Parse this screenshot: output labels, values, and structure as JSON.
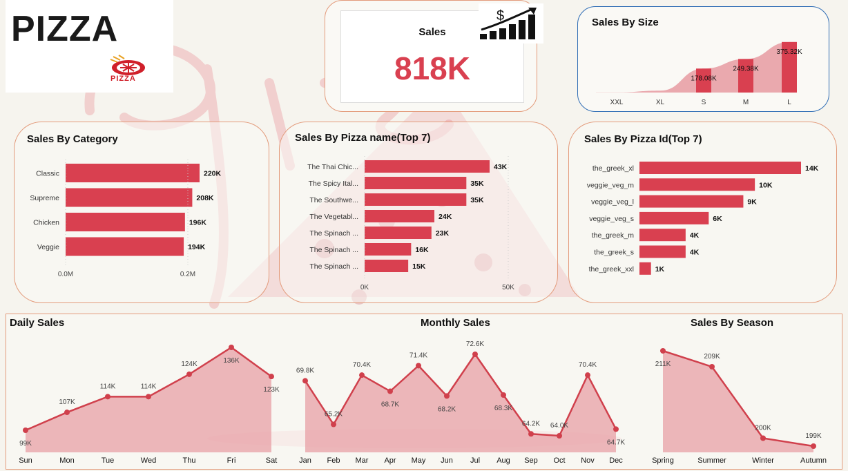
{
  "logo": {
    "word": "PIZZA",
    "sub": "PIZZA"
  },
  "kpi": {
    "label": "Sales",
    "value": "818K",
    "icon": "dollar-growth-bars-icon"
  },
  "colors": {
    "bar": "#d94050",
    "area": "#e8a0a6",
    "line": "#d0404c",
    "accent_border": "#e39a7a",
    "size_border": "#2f6db5"
  },
  "chart_data": [
    {
      "id": "size",
      "type": "area",
      "title": "Sales By Size",
      "categories": [
        "XXL",
        "XL",
        "S",
        "M",
        "L"
      ],
      "values": [
        1006,
        14076,
        178076,
        249382,
        375319
      ],
      "data_labels": [
        "",
        "",
        "178.08K",
        "249.38K",
        "375.32K"
      ]
    },
    {
      "id": "category",
      "type": "bar",
      "orientation": "horizontal",
      "title": "Sales By Category",
      "categories": [
        "Classic",
        "Supreme",
        "Chicken",
        "Veggie"
      ],
      "values": [
        220000,
        208000,
        196000,
        194000
      ],
      "data_labels": [
        "220K",
        "208K",
        "196K",
        "194K"
      ],
      "xlim": [
        0,
        0.2
      ],
      "tick_labels": [
        "0.0M",
        "0.2M"
      ]
    },
    {
      "id": "pizza_name",
      "type": "bar",
      "orientation": "horizontal",
      "title": "Sales By Pizza name(Top 7)",
      "categories": [
        "The Thai Chic...",
        "The Spicy Ital...",
        "The Southwe...",
        "The Vegetabl...",
        "The Spinach ...",
        "The Spinach ...",
        "The Spinach ..."
      ],
      "values": [
        43000,
        35000,
        35000,
        24000,
        23000,
        16000,
        15000
      ],
      "data_labels": [
        "43K",
        "35K",
        "35K",
        "24K",
        "23K",
        "16K",
        "15K"
      ],
      "xlim": [
        0,
        50
      ],
      "tick_labels": [
        "0K",
        "50K"
      ]
    },
    {
      "id": "pizza_id",
      "type": "bar",
      "orientation": "horizontal",
      "title": "Sales By Pizza Id(Top 7)",
      "categories": [
        "the_greek_xl",
        "veggie_veg_m",
        "veggie_veg_l",
        "veggie_veg_s",
        "the_greek_m",
        "the_greek_s",
        "the_greek_xxl"
      ],
      "values": [
        14000,
        10000,
        9000,
        6000,
        4000,
        4000,
        1000
      ],
      "data_labels": [
        "14K",
        "10K",
        "9K",
        "6K",
        "4K",
        "4K",
        "1K"
      ]
    },
    {
      "id": "daily",
      "type": "area",
      "title": "Daily Sales",
      "categories": [
        "Sun",
        "Mon",
        "Tue",
        "Wed",
        "Thu",
        "Fri",
        "Sat"
      ],
      "values": [
        99,
        107,
        114,
        114,
        124,
        136,
        123
      ],
      "data_labels": [
        "99K",
        "107K",
        "114K",
        "114K",
        "124K",
        "136K",
        "123K"
      ]
    },
    {
      "id": "monthly",
      "type": "area",
      "title": "Monthly Sales",
      "categories": [
        "Jan",
        "Feb",
        "Mar",
        "Apr",
        "May",
        "Jun",
        "Jul",
        "Aug",
        "Sep",
        "Oct",
        "Nov",
        "Dec"
      ],
      "values": [
        69.8,
        65.2,
        70.4,
        68.7,
        71.4,
        68.2,
        72.6,
        68.3,
        64.2,
        64.0,
        70.4,
        64.7
      ],
      "data_labels": [
        "69.8K",
        "65.2K",
        "70.4K",
        "68.7K",
        "71.4K",
        "68.2K",
        "72.6K",
        "68.3K",
        "64.2K",
        "64.0K",
        "70.4K",
        "64.7K"
      ]
    },
    {
      "id": "season",
      "type": "area",
      "title": "Sales By Season",
      "categories": [
        "Spring",
        "Summer",
        "Winter",
        "Autumn"
      ],
      "values": [
        211,
        209,
        200,
        199
      ],
      "data_labels": [
        "211K",
        "209K",
        "200K",
        "199K"
      ]
    }
  ]
}
